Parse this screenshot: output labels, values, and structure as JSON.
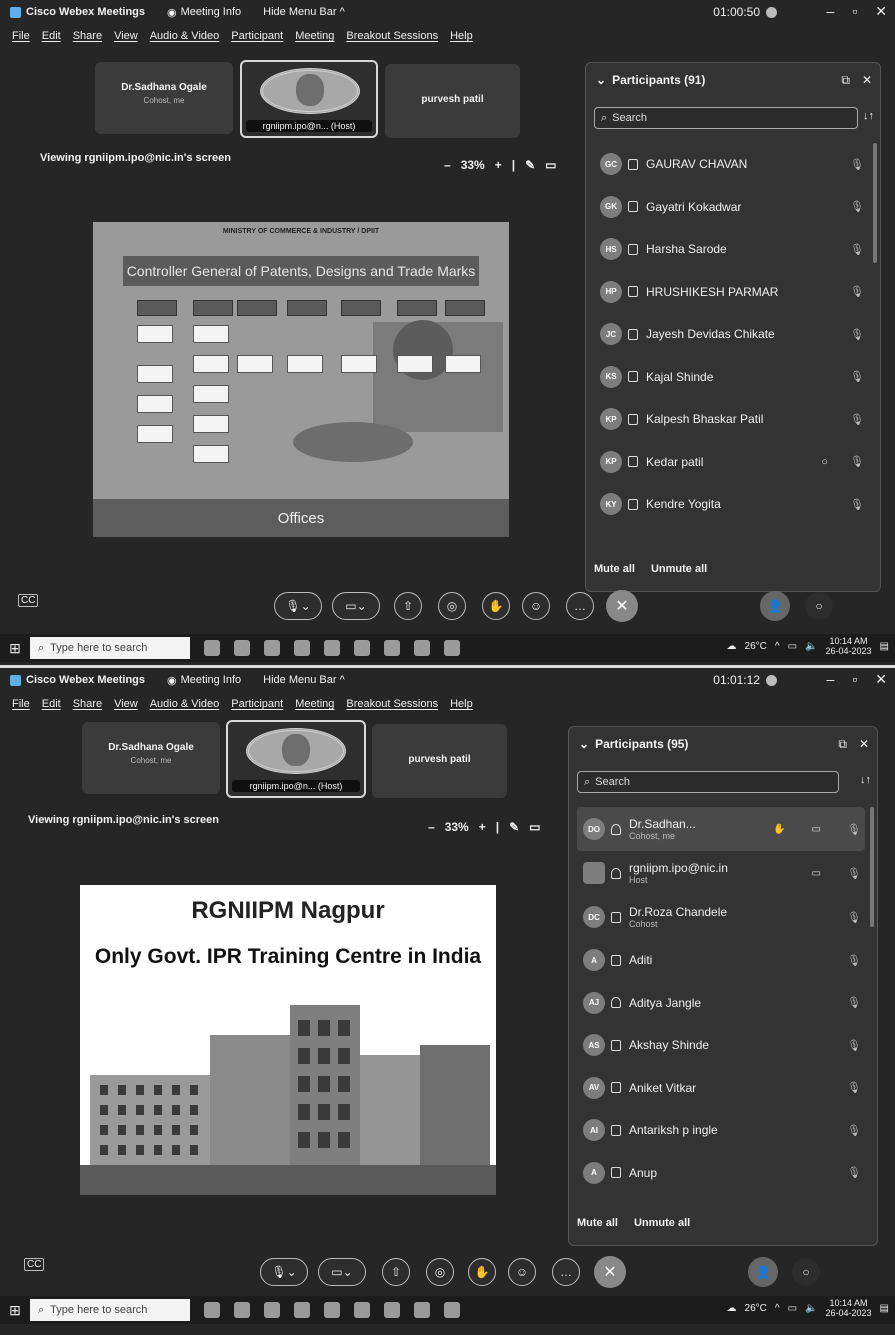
{
  "shot1": {
    "titlebar": {
      "app_title": "Cisco Webex Meetings",
      "meeting_info": "Meeting Info",
      "hide_menu_bar": "Hide Menu Bar ^",
      "timer": "01:00:50"
    },
    "menu": [
      "File",
      "Edit",
      "Share",
      "View",
      "Audio & Video",
      "Participant",
      "Meeting",
      "Breakout Sessions",
      "Help"
    ],
    "tiles": {
      "left": {
        "name": "Dr.Sadhana Ogale",
        "sub": "Cohost, me"
      },
      "host": {
        "label": "rgniipm.ipo@n... (Host)"
      },
      "right": {
        "name": "purvesh patil"
      }
    },
    "viewing": "Viewing rgniipm.ipo@nic.in's screen",
    "zoom": "33%",
    "slide": {
      "ministry": "MINISTRY OF COMMERCE & INDUSTRY / DPIIT",
      "banner": "Controller General of Patents, Designs and Trade Marks",
      "footer": "Offices"
    },
    "participants": {
      "header": "Participants (91)",
      "search_placeholder": "Search",
      "list": [
        {
          "initials": "GC",
          "name": "GAURAV CHAVAN"
        },
        {
          "initials": "GK",
          "name": "Gayatri Kokadwar"
        },
        {
          "initials": "HS",
          "name": "Harsha Sarode"
        },
        {
          "initials": "HP",
          "name": "HRUSHIKESH PARMAR"
        },
        {
          "initials": "JC",
          "name": "Jayesh Devidas Chikate"
        },
        {
          "initials": "KS",
          "name": "Kajal Shinde"
        },
        {
          "initials": "KP",
          "name": "Kalpesh Bhaskar Patil"
        },
        {
          "initials": "KP",
          "name": "Kedar patil",
          "chat": true
        },
        {
          "initials": "KY",
          "name": "Kendre Yogita"
        }
      ],
      "mute_all": "Mute all",
      "unmute_all": "Unmute all"
    },
    "taskbar": {
      "search_placeholder": "Type here to search",
      "temp": "26°C",
      "time": "10:14 AM",
      "date": "26-04-2023"
    }
  },
  "shot2": {
    "titlebar": {
      "app_title": "Cisco Webex Meetings",
      "meeting_info": "Meeting Info",
      "hide_menu_bar": "Hide Menu Bar ^",
      "timer": "01:01:12"
    },
    "menu": [
      "File",
      "Edit",
      "Share",
      "View",
      "Audio & Video",
      "Participant",
      "Meeting",
      "Breakout Sessions",
      "Help"
    ],
    "tiles": {
      "left": {
        "name": "Dr.Sadhana Ogale",
        "sub": "Cohost, me"
      },
      "host": {
        "label": "rgniipm.ipo@n... (Host)"
      },
      "right": {
        "name": "purvesh patil"
      }
    },
    "viewing": "Viewing rgniipm.ipo@nic.in's screen",
    "zoom": "33%",
    "slide": {
      "title": "RGNIIPM Nagpur",
      "subtitle": "Only Govt. IPR Training Centre in India"
    },
    "participants": {
      "header": "Participants (95)",
      "search_placeholder": "Search",
      "list": [
        {
          "initials": "DO",
          "name": "Dr.Sadhan...",
          "sub": "Cohost, me"
        },
        {
          "initials": "",
          "name": "rgniipm.ipo@nic.in",
          "sub": "Host"
        },
        {
          "initials": "DC",
          "name": "Dr.Roza Chandele",
          "sub": "Cohost"
        },
        {
          "initials": "A",
          "name": "Aditi"
        },
        {
          "initials": "AJ",
          "name": "Aditya Jangle"
        },
        {
          "initials": "AS",
          "name": "Akshay Shinde"
        },
        {
          "initials": "AV",
          "name": "Aniket Vitkar"
        },
        {
          "initials": "AI",
          "name": "Antariksh p ingle"
        },
        {
          "initials": "A",
          "name": "Anup"
        }
      ],
      "mute_all": "Mute all",
      "unmute_all": "Unmute all"
    },
    "taskbar": {
      "search_placeholder": "Type here to search",
      "temp": "26°C",
      "time": "10:14 AM",
      "date": "26-04-2023"
    }
  }
}
